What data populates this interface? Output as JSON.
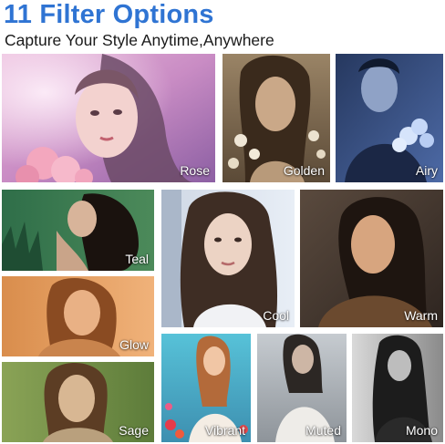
{
  "header": {
    "title": "11 Filter Options",
    "subtitle": "Capture Your Style Anytime,Anywhere"
  },
  "filters": [
    {
      "label": "Rose"
    },
    {
      "label": "Golden"
    },
    {
      "label": "Airy"
    },
    {
      "label": "Teal"
    },
    {
      "label": "Cool"
    },
    {
      "label": "Warm"
    },
    {
      "label": "Glow"
    },
    {
      "label": "Sage"
    },
    {
      "label": "Vibrant"
    },
    {
      "label": "Muted"
    },
    {
      "label": "Mono"
    }
  ],
  "colors": {
    "title": "#2f74d3",
    "subtitle": "#1a1a1a",
    "label": "#ffffff"
  }
}
